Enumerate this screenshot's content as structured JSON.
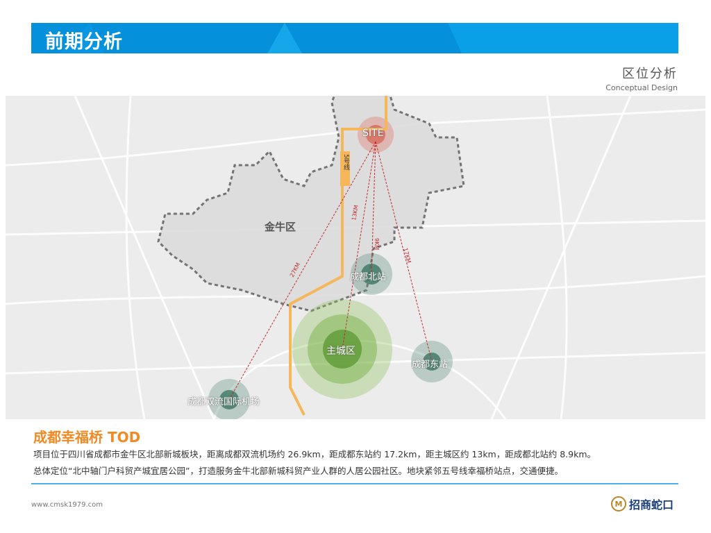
{
  "header": {
    "title": "前期分析",
    "section_cn": "区位分析",
    "section_en": "Conceptual Design"
  },
  "map": {
    "district": "金牛区",
    "site": "SITE",
    "metro": "5号线",
    "places": [
      "成都北站",
      "主城区",
      "成都东站",
      "成都双流国际机场"
    ],
    "distances": [
      "27KM",
      "13KM",
      "9KM",
      "17KM"
    ]
  },
  "project": {
    "title": "成都幸福桥 TOD",
    "line1": "项目位于四川省成都市金牛区北部新城板块，距离成都双流机场约 26.9km，距成都东站约 17.2km，距主城区约 13km，距成都北站约 8.9km。",
    "line2": "总体定位“北中轴门户科贸产城宜居公园”，打造服务金牛北部新城科贸产业人群的人居公园社区。地块紧邻五号线幸福桥站点，交通便捷。"
  },
  "footer": {
    "url": "www.cmsk1979.com",
    "logo": "招商蛇口"
  },
  "colors": {
    "banner": "#0590dc",
    "accent": "#f08a24"
  }
}
